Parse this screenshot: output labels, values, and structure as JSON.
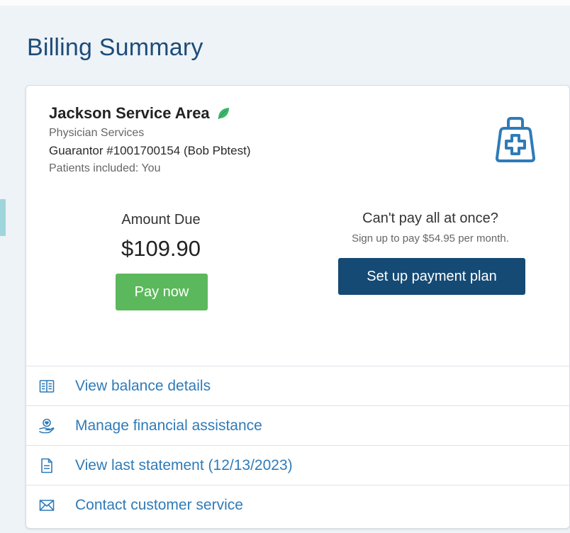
{
  "page": {
    "title": "Billing Summary"
  },
  "account": {
    "name": "Jackson Service Area",
    "service": "Physician Services",
    "guarantor": "Guarantor #1001700154 (Bob Pbtest)",
    "patients": "Patients included: You"
  },
  "amount_due": {
    "label": "Amount Due",
    "value": "$109.90",
    "pay_label": "Pay now"
  },
  "payment_plan": {
    "question": "Can't pay all at once?",
    "subtext": "Sign up to pay $54.95 per month.",
    "button_label": "Set up payment plan"
  },
  "links": [
    {
      "label": "View balance details",
      "icon": "book-icon"
    },
    {
      "label": "Manage financial assistance",
      "icon": "hand-heart-icon"
    },
    {
      "label": "View last statement (12/13/2023)",
      "icon": "document-icon"
    },
    {
      "label": "Contact customer service",
      "icon": "envelope-icon"
    }
  ],
  "colors": {
    "title": "#1d4c7a",
    "pay_button": "#5cb85c",
    "plan_button": "#154a74",
    "link": "#2f7bb8",
    "leaf": "#3cb56b",
    "bag_icon": "#2f7bb8"
  }
}
